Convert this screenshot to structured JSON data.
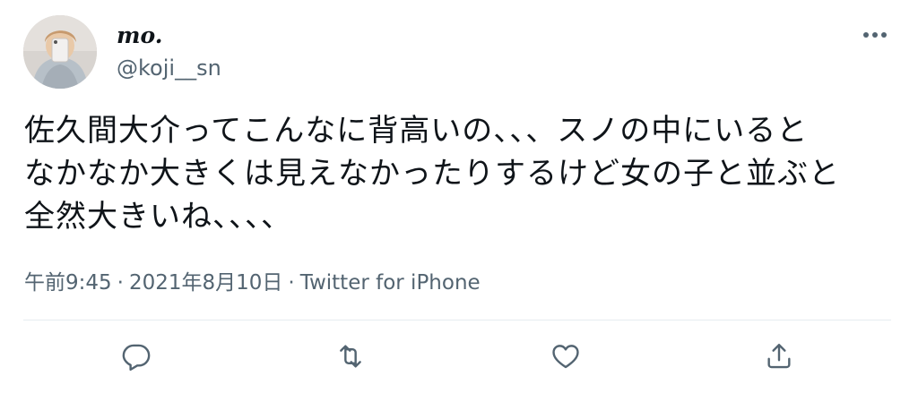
{
  "user": {
    "display_name": "mo.",
    "handle": "@koji__sn"
  },
  "tweet": {
    "text": "佐久間大介ってこんなに背高いの、、、スノの中にいると\nなかなか大きくは見えなかったりするけど女の子と並ぶと\n全然大きいね、、、、",
    "time": "午前9:45",
    "separator": "·",
    "date": "2021年8月10日",
    "source": "Twitter for iPhone"
  },
  "icons": {
    "more": "more-horizontal-icon",
    "reply": "reply-icon",
    "retweet": "retweet-icon",
    "like": "heart-icon",
    "share": "share-icon"
  },
  "colors": {
    "text_primary": "#0f1419",
    "text_secondary": "#536471",
    "divider": "#e6ecf0"
  }
}
